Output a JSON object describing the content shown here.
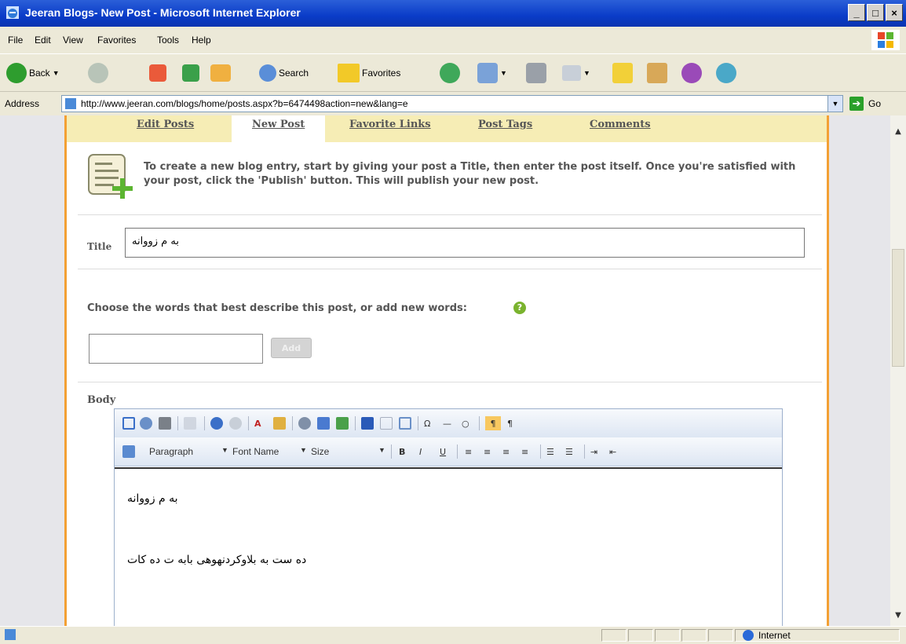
{
  "window": {
    "title": "Jeeran Blogs- New Post - Microsoft Internet Explorer",
    "min": "_",
    "max": "□",
    "close": "×"
  },
  "menu": [
    "File",
    "Edit",
    "View",
    "Favorites",
    "Tools",
    "Help"
  ],
  "toolbar": {
    "back": "Back",
    "search": "Search",
    "favorites": "Favorites"
  },
  "address": {
    "label": "Address",
    "url": "http://www.jeeran.com/blogs/home/posts.aspx?b=6474498action=new&lang=e",
    "go": "Go"
  },
  "tabs": [
    "Edit Posts",
    "New Post",
    "Favorite Links",
    "Post Tags",
    "Comments"
  ],
  "info": "To create a new blog entry, start by giving your post a Title, then enter the post itself. Once you're satisfied with your post, click the 'Publish' button. This will publish your new post.",
  "title_label": "Title",
  "title_value": "به م زووانه",
  "choose_label": "Choose the words that best describe this post, or add new words:",
  "help_icon": "?",
  "add_button": "Add",
  "body_label": "Body",
  "editor": {
    "paragraph": "Paragraph",
    "font_name": "Font Name",
    "size": "Size",
    "bold": "B",
    "italic": "I",
    "underline": "U",
    "line1": "به م زووانه",
    "line2": "ده ست به بلاوكردنهوهى بابه ت ده كات"
  },
  "status": {
    "zone": "Internet"
  }
}
